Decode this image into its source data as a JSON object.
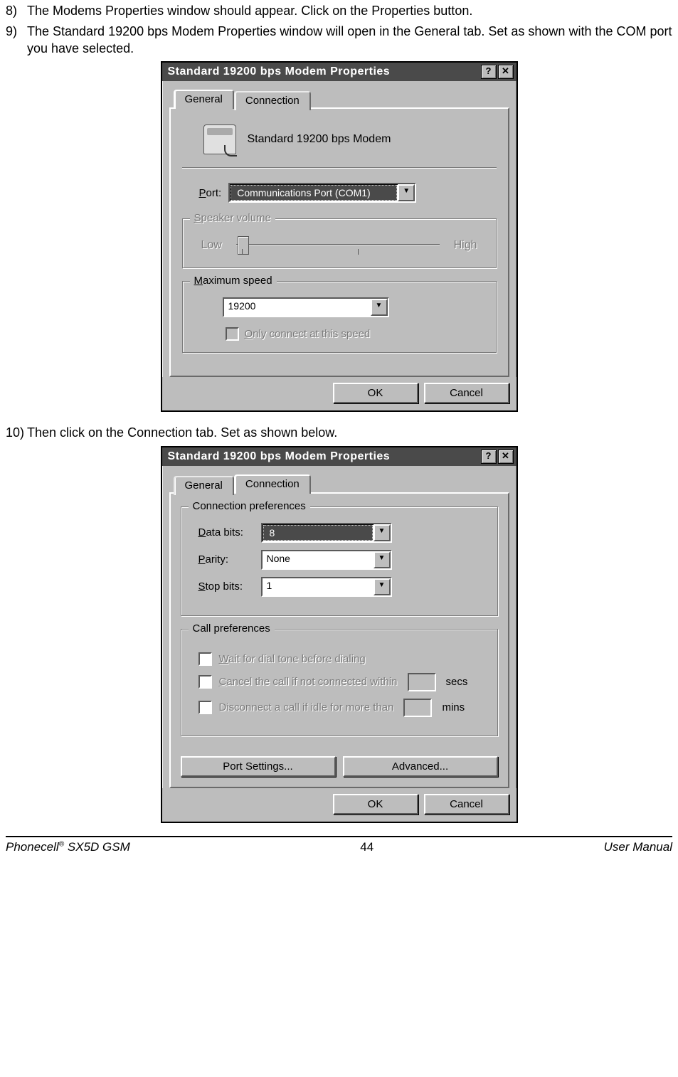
{
  "instructions": {
    "i8_num": "8)",
    "i8_text": "The Modems Properties window should appear. Click on the Properties button.",
    "i9_num": "9)",
    "i9_text": "The Standard 19200 bps Modem Properties window will open in the General tab. Set as shown with the COM port you have selected.",
    "i10_num": "10)",
    "i10_text": "Then click on the Connection tab. Set as shown below."
  },
  "dialog1": {
    "title": "Standard 19200 bps Modem Properties",
    "help_btn": "?",
    "close_btn": "✕",
    "tab_general": "General",
    "tab_connection": "Connection",
    "modem_name": "Standard 19200 bps Modem",
    "port_label": "Port:",
    "port_value": "Communications Port (COM1)",
    "speaker_legend": "Speaker volume",
    "low": "Low",
    "high": "High",
    "max_legend": "Maximum speed",
    "speed_value": "19200",
    "only_connect": "Only connect at this speed",
    "ok": "OK",
    "cancel": "Cancel"
  },
  "dialog2": {
    "title": "Standard 19200 bps Modem Properties",
    "help_btn": "?",
    "close_btn": "✕",
    "tab_general": "General",
    "tab_connection": "Connection",
    "conn_legend": "Connection preferences",
    "data_bits_label": "Data bits:",
    "data_bits_value": "8",
    "parity_label": "Parity:",
    "parity_value": "None",
    "stop_bits_label": "Stop bits:",
    "stop_bits_value": "1",
    "call_legend": "Call preferences",
    "wait_dial": "Wait for dial tone before dialing",
    "cancel_call": "Cancel the call if not connected within",
    "secs": "secs",
    "disconnect_idle": "Disconnect a call if idle for more than",
    "mins": "mins",
    "port_settings": "Port Settings...",
    "advanced": "Advanced...",
    "ok": "OK",
    "cancel": "Cancel"
  },
  "footer": {
    "left_a": "Phonecell",
    "left_b": " SX5D GSM",
    "reg": "®",
    "center": "44",
    "right": "User Manual"
  }
}
